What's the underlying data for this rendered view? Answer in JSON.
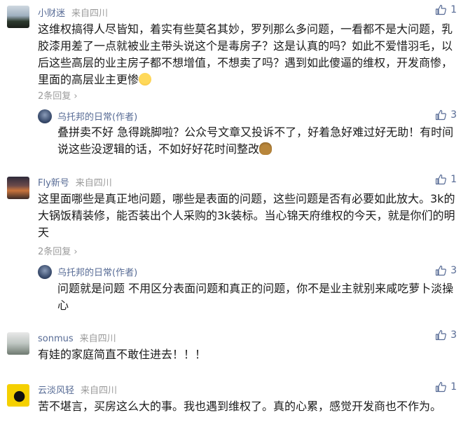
{
  "comments": [
    {
      "user": "小财迷",
      "location": "来自四川",
      "likes": "1",
      "text": "这维权搞得人尽皆知，着实有些莫名其妙，罗列那么多问题，一看都不是大问题，乳胶漆用差了一点就被业主带头说这个是毒房子？这是认真的吗？如此不爱惜羽毛，以后这些高层的业主房子都不想增值，不想卖了吗？遇到如此傻逼的维权，开发商惨，里面的高层业主更惨",
      "emoji": "pleading-face-emoji",
      "replies_label": "2条回复",
      "reply": {
        "user": "乌托邦的日常",
        "tag": "(作者)",
        "likes": "3",
        "text": "叠拼卖不好 急得跳脚啦？公众号文章又投诉不了，好着急好难过好无助！有时间说这些没逻辑的话，不如好好花时间整改",
        "emoji": "poop-emoji"
      }
    },
    {
      "user": "Fly新号",
      "location": "来自四川",
      "likes": "1",
      "text": "这里面哪些是真正地问题，哪些是表面的问题，这些问题是否有必要如此放大。3k的大锅饭精装修，能否装出个人采购的3k装标。当心锦天府维权的今天，就是你们的明天",
      "replies_label": "2条回复",
      "reply": {
        "user": "乌托邦的日常",
        "tag": "(作者)",
        "likes": "3",
        "text": "问题就是问题 不用区分表面问题和真正的问题，你不是业主就别来咸吃萝卜淡操心"
      }
    },
    {
      "user": "sonmus",
      "location": "来自四川",
      "likes": "3",
      "text": "有娃的家庭简直不敢住进去！！！"
    },
    {
      "user": "云淡风轻",
      "location": "来自四川",
      "likes": "1",
      "text": "苦不堪言，买房这么大的事。我也遇到维权了。真的心累，感觉开发商也不作为。"
    }
  ],
  "colors": {
    "link": "#576b95",
    "muted": "#9a9a9a",
    "text": "#1a1a1a"
  }
}
